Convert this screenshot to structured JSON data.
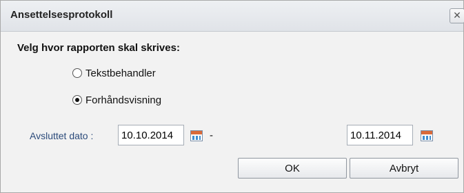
{
  "window": {
    "title": "Ansettelsesprotokoll",
    "close_glyph": "✕"
  },
  "section": {
    "label": "Velg hvor rapporten skal skrives:"
  },
  "options": [
    {
      "label": "Tekstbehandler",
      "checked": false
    },
    {
      "label": "Forhåndsvisning",
      "checked": true
    }
  ],
  "date": {
    "label": "Avsluttet dato :",
    "from": "10.10.2014",
    "separator": "-",
    "to": "10.11.2014",
    "icon": "calendar-icon"
  },
  "buttons": {
    "ok": "OK",
    "cancel": "Avbryt"
  }
}
